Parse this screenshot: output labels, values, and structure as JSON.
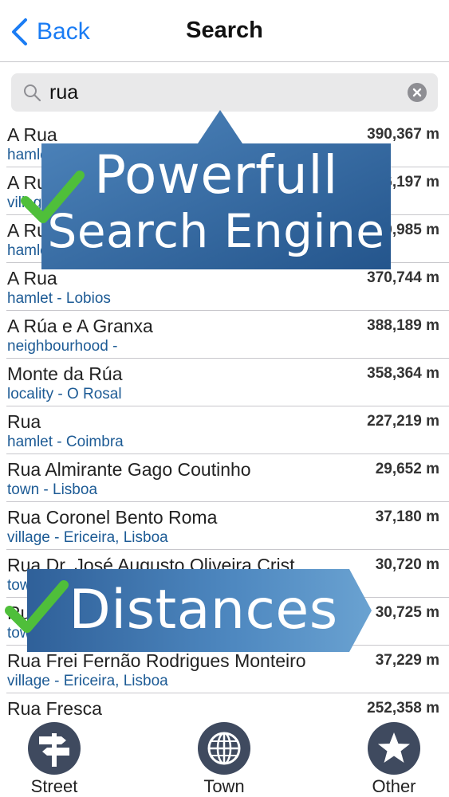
{
  "navbar": {
    "back_label": "Back",
    "title": "Search"
  },
  "search": {
    "value": "rua"
  },
  "results": [
    {
      "name": "A Rua",
      "sub": "hamlet",
      "distance": "390,367 m"
    },
    {
      "name": "A Rua",
      "sub": "village",
      "distance": "376,197 m"
    },
    {
      "name": "A Rua",
      "sub": "hamlet",
      "distance": "380,985 m"
    },
    {
      "name": "A Rua",
      "sub": "hamlet - Lobios",
      "distance": "370,744 m"
    },
    {
      "name": "A Rúa e A Granxa",
      "sub": "neighbourhood -",
      "distance": "388,189 m"
    },
    {
      "name": "Monte da Rúa",
      "sub": "locality - O Rosal",
      "distance": "358,364 m"
    },
    {
      "name": "Rua",
      "sub": "hamlet - Coimbra",
      "distance": "227,219 m"
    },
    {
      "name": "Rua Almirante Gago Coutinho",
      "sub": "town - Lisboa",
      "distance": "29,652 m"
    },
    {
      "name": "Rua Coronel Bento Roma",
      "sub": "village - Ericeira, Lisboa",
      "distance": "37,180 m"
    },
    {
      "name": "Rua Dr. José Augusto Oliveira Crist",
      "sub": "town",
      "distance": "30,720 m"
    },
    {
      "name": "Rua",
      "sub": "town",
      "distance": "30,725 m"
    },
    {
      "name": "Rua Frei Fernão Rodrigues Monteiro",
      "sub": "village - Ericeira, Lisboa",
      "distance": "37,229 m"
    },
    {
      "name": "Rua Fresca",
      "sub": "",
      "distance": "252,358 m"
    }
  ],
  "banners": {
    "search_line1": "Powerfull",
    "search_line2": "Search Engine",
    "distances": "Distances"
  },
  "tabs": [
    {
      "label": "Street",
      "icon": "signpost-icon"
    },
    {
      "label": "Town",
      "icon": "globe-icon"
    },
    {
      "label": "Other",
      "icon": "star-icon"
    }
  ],
  "colors": {
    "accent": "#1a7cf4",
    "subtitle": "#1d5b95",
    "banner": "#3a6fa6",
    "check": "#4fbf3a",
    "tab_circle": "#3f4a5f"
  }
}
